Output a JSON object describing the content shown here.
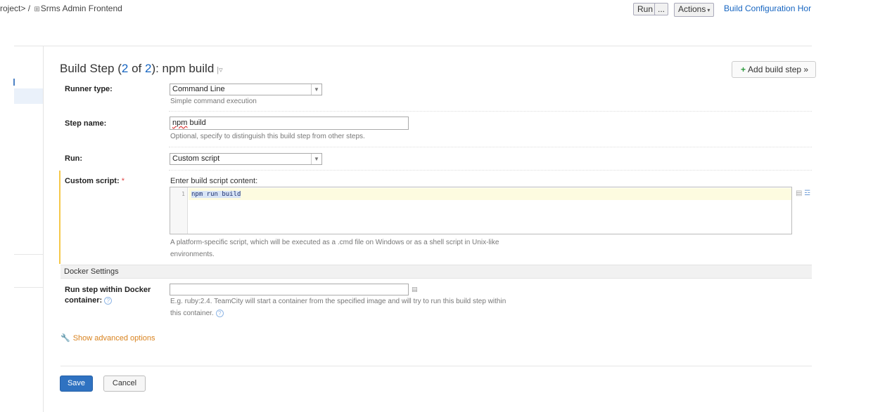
{
  "breadcrumb": {
    "project": "roject>",
    "separator": "/",
    "current": "Srms Admin Frontend"
  },
  "toolbar": {
    "run_label": "Run",
    "run_more_label": "...",
    "actions_label": "Actions",
    "config_link": "Build Configuration Hor"
  },
  "page": {
    "title_prefix": "Build Step (",
    "title_step": "2",
    "title_mid": " of ",
    "title_total": "2",
    "title_suffix": "): npm build",
    "add_step_label": "Add build step »"
  },
  "form": {
    "runner_type": {
      "label": "Runner type:",
      "value": "Command Line",
      "note": "Simple command execution"
    },
    "step_name": {
      "label": "Step name:",
      "value_misspelled": "npm",
      "value_rest": " build",
      "note": "Optional, specify to distinguish this build step from other steps."
    },
    "run": {
      "label": "Run:",
      "value": "Custom script"
    },
    "custom_script": {
      "label": "Custom script:",
      "required_mark": "*",
      "prompt": "Enter build script content:",
      "line_number": "1",
      "code": "npm run build",
      "note_line1": "A platform-specific script, which will be executed as a .cmd file on Windows or as a shell script in Unix-like",
      "note_line2": "environments."
    },
    "docker": {
      "section_title": "Docker Settings",
      "label_line1": "Run step within Docker",
      "label_line2": "container:",
      "value": "",
      "note_line1": "E.g. ruby:2.4. TeamCity will start a container from the specified image and will try to run this build step within",
      "note_line2": "this container."
    },
    "advanced_link": "Show advanced options",
    "save_label": "Save",
    "cancel_label": "Cancel"
  },
  "icons": {
    "help": "?",
    "field": "▤",
    "grid": "⊞",
    "select_arrow": "▼",
    "caret": "▾"
  },
  "colors": {
    "link": "#1665c1",
    "primary_button": "#2f72c1",
    "required_bar": "#f5c84a",
    "advanced_link": "#d9831f",
    "add_icon": "#2e9b3d"
  }
}
